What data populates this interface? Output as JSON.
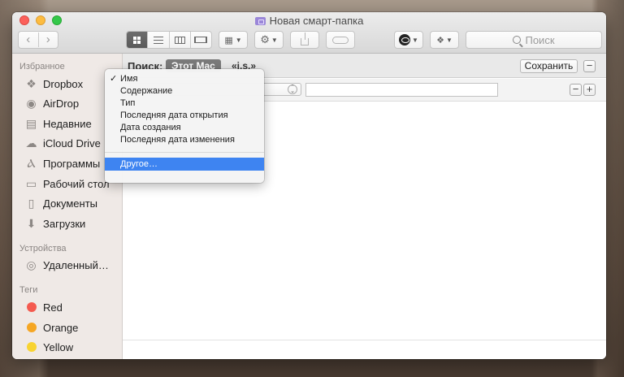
{
  "window": {
    "title": "Новая смарт-папка"
  },
  "toolbar": {
    "back": "‹",
    "forward": "›",
    "search_placeholder": "Поиск",
    "action_glyph": "⚙"
  },
  "sidebar": {
    "favorites_header": "Избранное",
    "favorites": [
      {
        "label": "Dropbox",
        "icon": "dropbox-icon",
        "glyph": "❖"
      },
      {
        "label": "AirDrop",
        "icon": "airdrop-icon",
        "glyph": "◉"
      },
      {
        "label": "Недавние",
        "icon": "recents-icon",
        "glyph": "▤"
      },
      {
        "label": "iCloud Drive",
        "icon": "cloud-icon",
        "glyph": "☁"
      },
      {
        "label": "Программы",
        "icon": "applications-icon",
        "glyph": "Ⲁ"
      },
      {
        "label": "Рабочий стол",
        "icon": "desktop-icon",
        "glyph": "▭"
      },
      {
        "label": "Документы",
        "icon": "documents-icon",
        "glyph": "▯"
      },
      {
        "label": "Загрузки",
        "icon": "downloads-icon",
        "glyph": "⬇"
      }
    ],
    "devices_header": "Устройства",
    "devices": [
      {
        "label": "Удаленный…",
        "icon": "remote-disc-icon",
        "glyph": "◎"
      }
    ],
    "tags_header": "Теги",
    "tags": [
      {
        "label": "Red",
        "color": "#f45a4f"
      },
      {
        "label": "Orange",
        "color": "#f5a623"
      },
      {
        "label": "Yellow",
        "color": "#f8d330"
      }
    ]
  },
  "search": {
    "label": "Поиск:",
    "scope_active": "Этот Mac",
    "scope_other": "«j.s.»",
    "save_label": "Сохранить",
    "minus": "−",
    "plus": "+"
  },
  "menu": {
    "items": [
      {
        "label": "Имя",
        "checked": true
      },
      {
        "label": "Содержание"
      },
      {
        "label": "Тип"
      },
      {
        "label": "Последняя дата открытия"
      },
      {
        "label": "Дата создания"
      },
      {
        "label": "Последняя дата изменения"
      }
    ],
    "other": "Другое…",
    "check_glyph": "✓"
  }
}
